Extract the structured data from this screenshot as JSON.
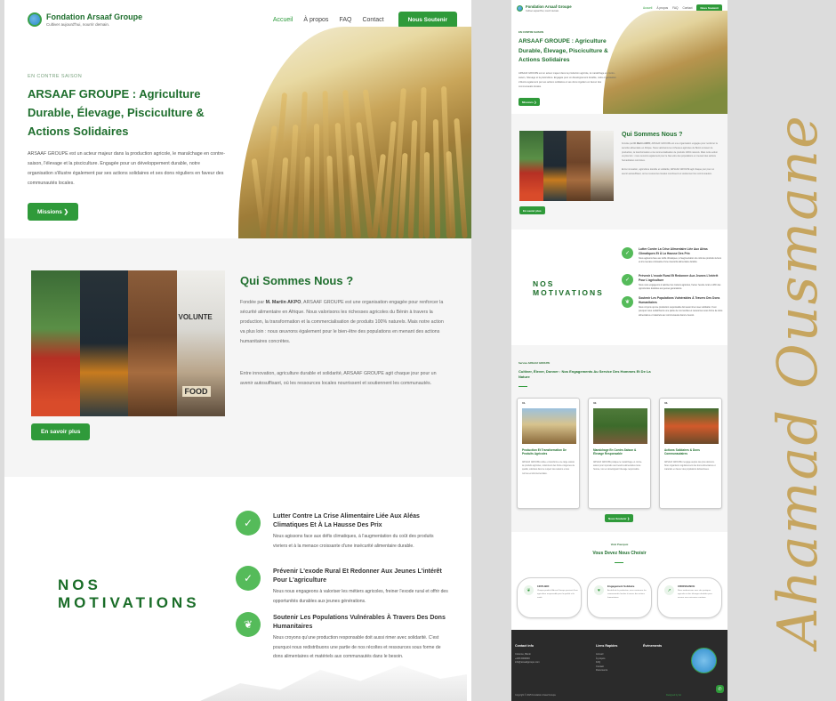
{
  "site": {
    "logo_title": "Fondation Arsaaf Groupe",
    "logo_subtitle": "Cultiver aujourd'hui, nourrir demain.",
    "nav": [
      "Accueil",
      "À propos",
      "FAQ",
      "Contact"
    ],
    "cta": "Nous Soutenir"
  },
  "hero": {
    "kicker": "EN CONTRE SAISON",
    "title": "ARSAAF GROUPE : Agriculture Durable, Élevage, Pisciculture & Actions Solidaires",
    "description": "ARSAAF GROUPE est un acteur majeur dans la production agricole, le maraîchage en contre-saison, l'élevage et la pisciculture. Engagée pour un développement durable, notre organisation s'illustre également par ses actions solidaires et ses dons réguliers en faveur des communautés locales.",
    "button": "Missions ❯"
  },
  "about": {
    "title": "Qui Sommes Nous ?",
    "p1_prefix": "Fondée par",
    "p1_founder": "M. Martin AKPO",
    "p1_rest": ", ARSAAF GROUPE est une organisation engagée pour renforcer la sécurité alimentaire en Afrique. Nous valorisons les richesses agricoles du Bénin à travers la production, la transformation et la commercialisation de produits 100% naturels. Mais notre action va plus loin : nous œuvrons également pour le bien-être des populations en menant des actions humanitaires concrètes.",
    "p2": "Entre innovation, agriculture durable et solidarité, ARSAAF GROUPE agit chaque jour pour un avenir autosuffisant, où les ressources locales nourrissent et soutiennent les communautés.",
    "button": "En savoir plus",
    "image_labels": {
      "volunteer": "VOLUNTE",
      "food": "FOOD"
    }
  },
  "motivations": {
    "title_line1": "NOS",
    "title_line2": "MOTIVATIONS",
    "items": [
      {
        "heading": "Lutter Contre La Crise Alimentaire Liée Aux Aléas Climatiques Et À La Hausse Des Prix",
        "text": "Nous agissons face aux défis climatiques, à l'augmentation du coût des produits vivriers et à la menace croissante d'une insécurité alimentaire durable.",
        "icon": "check-icon"
      },
      {
        "heading": "Prévenir L'exode Rural Et Redonner Aux Jeunes L'intérêt Pour L'agriculture",
        "text": "Nous nous engageons à valoriser les métiers agricoles, freiner l'exode rural et offrir des opportunités durables aux jeunes générations.",
        "icon": "check-icon"
      },
      {
        "heading": "Soutenir Les Populations Vulnérables À Travers Des Dons Humanitaires",
        "text": "Nous croyons qu'une production responsable doit aussi rimer avec solidarité. C'est pourquoi nous redistribuons une partie de nos récoltes et ressources sous forme de dons alimentaires et matériels aux communautés dans le besoin.",
        "icon": "leaf-icon"
      }
    ]
  },
  "services": {
    "kicker": "Service ARSAAF GROUPE",
    "title": "Cultiver, Élever, Donner : Nos Engagements Au Service Des Hommes Et De La Nature",
    "cards": [
      {
        "num": "01.",
        "title": "Production Et Transformation De Produits Agricoles",
        "text": "ARSAAF GROUPE cultive et transforme une large variété de produits agricoles, notamment des fruits et légumes de qualité, valorisés dans le respect des saisons et des normes environnementales."
      },
      {
        "num": "02.",
        "title": "Maraîchage En Contre-Saison & Élevage Responsable",
        "text": "ARSAAF GROUPE pratique le maraîchage en contre-saison pour répondre aux besoins alimentaires toute l'année, tout en développant l'élevage responsable."
      },
      {
        "num": "03.",
        "title": "Actions Solidaires & Dons Communautaires",
        "text": "ARSAAF GROUPE s'engage auprès des plus démunis. Nous organisons régulièrement des dons alimentaires et matériels en faveur des populations défavorisées."
      }
    ],
    "button": "Nous Soutenir ❯"
  },
  "why": {
    "kicker": "Voici Pourquoi",
    "title": "Vous Devez Nous Choisir",
    "pills": [
      {
        "title": "100% BIO",
        "text": "Chaque produit d'Arsaaf Groupe provient d'une agriculture responsable pour la qualité et la santé."
      },
      {
        "title": "Engagement Solidaire",
        "text": "Au-delà de la production, nous soutenons les communautés locales à travers des actions humanitaires."
      },
      {
        "title": "CROISSANCE",
        "text": "Nous modernisons avec des pratiques agricoles et des élevages durables pour assurer une croissance continue."
      }
    ]
  },
  "footer": {
    "contact_title": "Contact info",
    "contact_lines": [
      "Cotonou, Bénin",
      "+229 0000000",
      "info@arsaafgroupe.com"
    ],
    "links_title": "Liens Rapides",
    "links": [
      "Accueil",
      "À propos",
      "FAQ",
      "Contact",
      "Documents"
    ],
    "events_title": "Événements",
    "copyright": "Copyright © 2025 Fondation Arsaaf Groupe",
    "credit": "Designed by AA"
  },
  "signature": {
    "text": "Ahamad Ousmane"
  },
  "colors": {
    "brand_green": "#2f9a3a",
    "title_green": "#1f6f2e",
    "signature_gold": "#c6a55f"
  }
}
